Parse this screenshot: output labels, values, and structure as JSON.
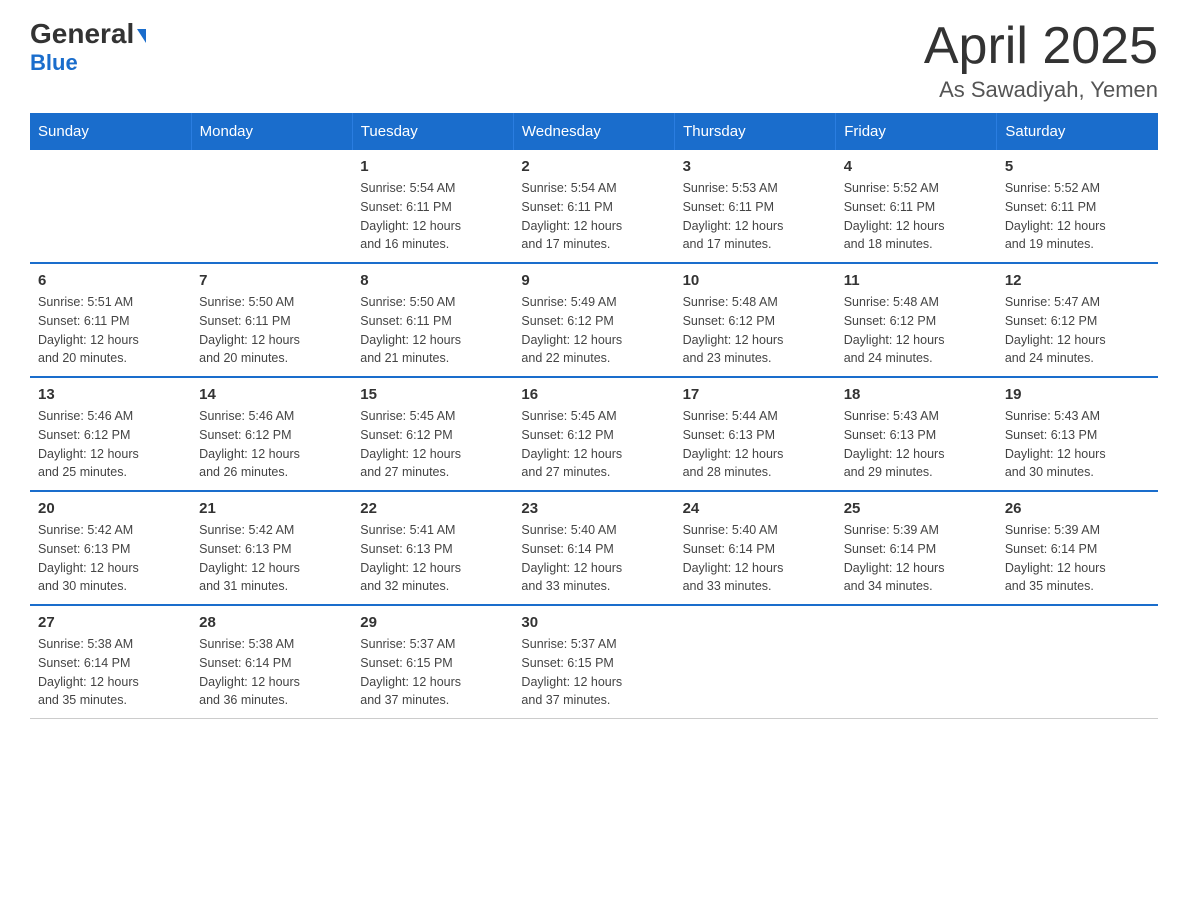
{
  "logo": {
    "line1": "General",
    "triangle": "▶",
    "line2": "Blue"
  },
  "title": "April 2025",
  "subtitle": "As Sawadiyah, Yemen",
  "weekdays": [
    "Sunday",
    "Monday",
    "Tuesday",
    "Wednesday",
    "Thursday",
    "Friday",
    "Saturday"
  ],
  "weeks": [
    [
      {
        "day": "",
        "info": ""
      },
      {
        "day": "",
        "info": ""
      },
      {
        "day": "1",
        "info": "Sunrise: 5:54 AM\nSunset: 6:11 PM\nDaylight: 12 hours\nand 16 minutes."
      },
      {
        "day": "2",
        "info": "Sunrise: 5:54 AM\nSunset: 6:11 PM\nDaylight: 12 hours\nand 17 minutes."
      },
      {
        "day": "3",
        "info": "Sunrise: 5:53 AM\nSunset: 6:11 PM\nDaylight: 12 hours\nand 17 minutes."
      },
      {
        "day": "4",
        "info": "Sunrise: 5:52 AM\nSunset: 6:11 PM\nDaylight: 12 hours\nand 18 minutes."
      },
      {
        "day": "5",
        "info": "Sunrise: 5:52 AM\nSunset: 6:11 PM\nDaylight: 12 hours\nand 19 minutes."
      }
    ],
    [
      {
        "day": "6",
        "info": "Sunrise: 5:51 AM\nSunset: 6:11 PM\nDaylight: 12 hours\nand 20 minutes."
      },
      {
        "day": "7",
        "info": "Sunrise: 5:50 AM\nSunset: 6:11 PM\nDaylight: 12 hours\nand 20 minutes."
      },
      {
        "day": "8",
        "info": "Sunrise: 5:50 AM\nSunset: 6:11 PM\nDaylight: 12 hours\nand 21 minutes."
      },
      {
        "day": "9",
        "info": "Sunrise: 5:49 AM\nSunset: 6:12 PM\nDaylight: 12 hours\nand 22 minutes."
      },
      {
        "day": "10",
        "info": "Sunrise: 5:48 AM\nSunset: 6:12 PM\nDaylight: 12 hours\nand 23 minutes."
      },
      {
        "day": "11",
        "info": "Sunrise: 5:48 AM\nSunset: 6:12 PM\nDaylight: 12 hours\nand 24 minutes."
      },
      {
        "day": "12",
        "info": "Sunrise: 5:47 AM\nSunset: 6:12 PM\nDaylight: 12 hours\nand 24 minutes."
      }
    ],
    [
      {
        "day": "13",
        "info": "Sunrise: 5:46 AM\nSunset: 6:12 PM\nDaylight: 12 hours\nand 25 minutes."
      },
      {
        "day": "14",
        "info": "Sunrise: 5:46 AM\nSunset: 6:12 PM\nDaylight: 12 hours\nand 26 minutes."
      },
      {
        "day": "15",
        "info": "Sunrise: 5:45 AM\nSunset: 6:12 PM\nDaylight: 12 hours\nand 27 minutes."
      },
      {
        "day": "16",
        "info": "Sunrise: 5:45 AM\nSunset: 6:12 PM\nDaylight: 12 hours\nand 27 minutes."
      },
      {
        "day": "17",
        "info": "Sunrise: 5:44 AM\nSunset: 6:13 PM\nDaylight: 12 hours\nand 28 minutes."
      },
      {
        "day": "18",
        "info": "Sunrise: 5:43 AM\nSunset: 6:13 PM\nDaylight: 12 hours\nand 29 minutes."
      },
      {
        "day": "19",
        "info": "Sunrise: 5:43 AM\nSunset: 6:13 PM\nDaylight: 12 hours\nand 30 minutes."
      }
    ],
    [
      {
        "day": "20",
        "info": "Sunrise: 5:42 AM\nSunset: 6:13 PM\nDaylight: 12 hours\nand 30 minutes."
      },
      {
        "day": "21",
        "info": "Sunrise: 5:42 AM\nSunset: 6:13 PM\nDaylight: 12 hours\nand 31 minutes."
      },
      {
        "day": "22",
        "info": "Sunrise: 5:41 AM\nSunset: 6:13 PM\nDaylight: 12 hours\nand 32 minutes."
      },
      {
        "day": "23",
        "info": "Sunrise: 5:40 AM\nSunset: 6:14 PM\nDaylight: 12 hours\nand 33 minutes."
      },
      {
        "day": "24",
        "info": "Sunrise: 5:40 AM\nSunset: 6:14 PM\nDaylight: 12 hours\nand 33 minutes."
      },
      {
        "day": "25",
        "info": "Sunrise: 5:39 AM\nSunset: 6:14 PM\nDaylight: 12 hours\nand 34 minutes."
      },
      {
        "day": "26",
        "info": "Sunrise: 5:39 AM\nSunset: 6:14 PM\nDaylight: 12 hours\nand 35 minutes."
      }
    ],
    [
      {
        "day": "27",
        "info": "Sunrise: 5:38 AM\nSunset: 6:14 PM\nDaylight: 12 hours\nand 35 minutes."
      },
      {
        "day": "28",
        "info": "Sunrise: 5:38 AM\nSunset: 6:14 PM\nDaylight: 12 hours\nand 36 minutes."
      },
      {
        "day": "29",
        "info": "Sunrise: 5:37 AM\nSunset: 6:15 PM\nDaylight: 12 hours\nand 37 minutes."
      },
      {
        "day": "30",
        "info": "Sunrise: 5:37 AM\nSunset: 6:15 PM\nDaylight: 12 hours\nand 37 minutes."
      },
      {
        "day": "",
        "info": ""
      },
      {
        "day": "",
        "info": ""
      },
      {
        "day": "",
        "info": ""
      }
    ]
  ]
}
